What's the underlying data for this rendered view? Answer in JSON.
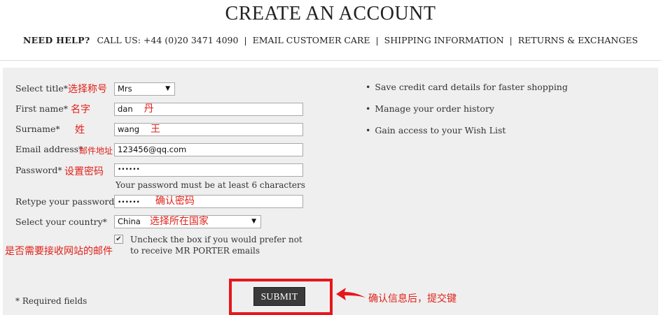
{
  "page": {
    "title": "CREATE AN ACCOUNT"
  },
  "help_bar": {
    "need_help": "NEED HELP?",
    "call_us": "CALL US: +44 (0)20 3471 4090",
    "links": [
      "EMAIL CUSTOMER CARE",
      "SHIPPING INFORMATION",
      "RETURNS & EXCHANGES"
    ],
    "separator": "|"
  },
  "form": {
    "title_label": "Select title*",
    "title_value": "Mrs",
    "first_name_label": "First name*",
    "first_name_value": "dan",
    "surname_label": "Surname*",
    "surname_value": "wang",
    "email_label": "Email address*",
    "email_value": "123456@qq.com",
    "password_label": "Password*",
    "password_value": "••••••",
    "password_hint": "Your password must be at least 6 characters",
    "retype_label": "Retype your password*",
    "retype_value": "••••••",
    "country_label": "Select your country*",
    "country_value": "China",
    "checkbox_checked": true,
    "checkbox_text": "Uncheck the box if you would prefer not to receive MR PORTER emails",
    "required_note": "* Required fields",
    "submit_label": "SUBMIT"
  },
  "benefits": [
    "Save credit card details for faster shopping",
    "Manage your order history",
    "Gain access to your Wish List"
  ],
  "annotations": {
    "title": "选择称号",
    "first_name_label": "名字",
    "first_name_inline": "丹",
    "surname_label": "姓",
    "surname_inline": "王",
    "email": "邮件地址",
    "password": "设置密码",
    "retype_inline": "确认密码",
    "country_inline": "选择所在国家",
    "newsletter": "是否需要接收网站的邮件",
    "submit": "确认信息后，提交键"
  },
  "colors": {
    "annotation": "#e0221a",
    "panel_bg": "#efefef",
    "button_bg": "#3a3a3a"
  }
}
